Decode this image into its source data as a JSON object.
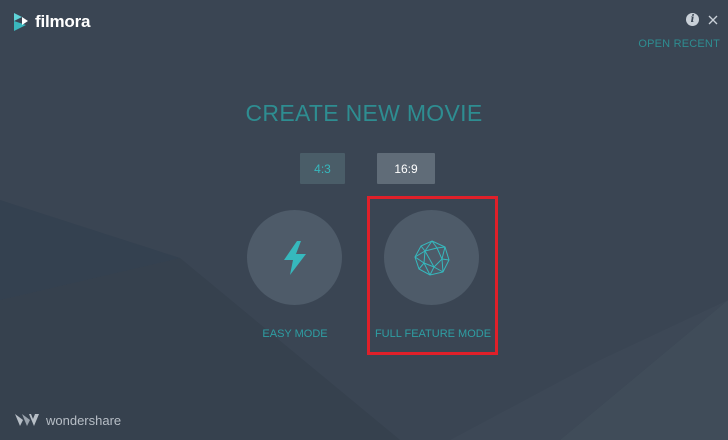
{
  "app": {
    "logo_text": "filmora"
  },
  "header": {
    "info_label": "i",
    "open_recent_label": "OPEN RECENT"
  },
  "main": {
    "title": "CREATE NEW MOVIE",
    "ratios": [
      {
        "label": "4:3",
        "selected": false
      },
      {
        "label": "16:9",
        "selected": true
      }
    ],
    "modes": [
      {
        "label": "EASY MODE",
        "icon": "lightning-icon"
      },
      {
        "label": "FULL FEATURE MODE",
        "icon": "polyhedron-icon",
        "highlighted": true
      }
    ]
  },
  "footer": {
    "brand_text": "wondershare"
  },
  "colors": {
    "background": "#3a4553",
    "accent": "#2e8d91",
    "icon_accent": "#36b8bd",
    "highlight": "#e0202a"
  }
}
